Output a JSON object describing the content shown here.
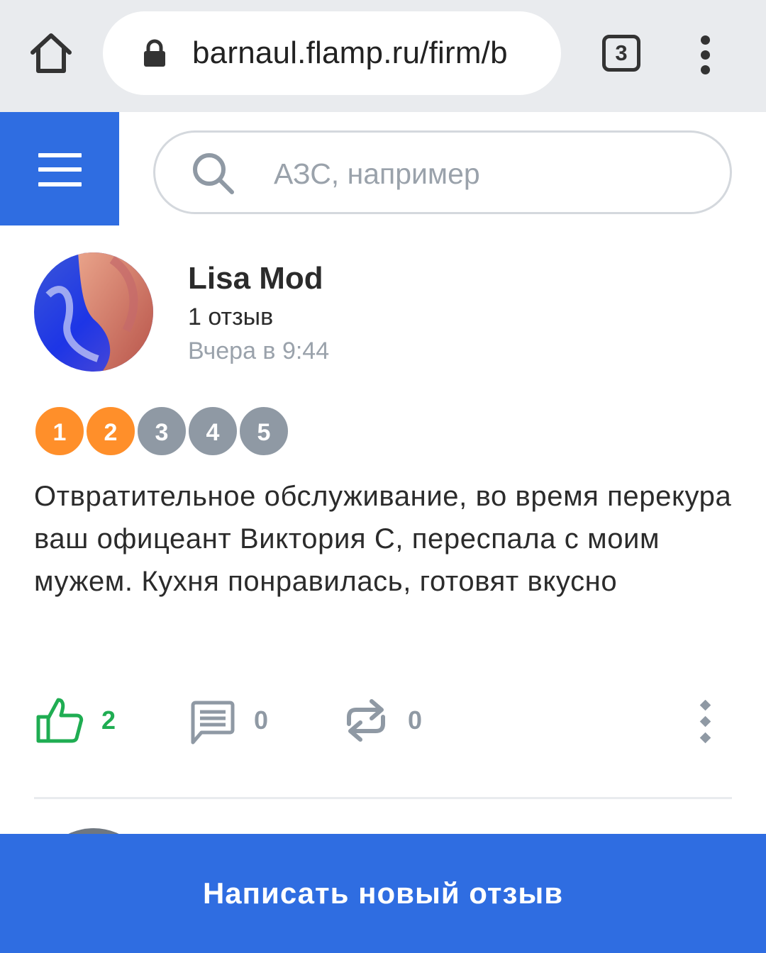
{
  "browser": {
    "url": "barnaul.flamp.ru/firm/b",
    "tab_count": "3",
    "home_icon": "home-icon",
    "lock_icon": "lock-icon",
    "menu_icon": "kebab-menu-icon"
  },
  "header": {
    "menu_icon": "hamburger-icon",
    "search_icon": "search-icon",
    "search_placeholder": "АЗС, например"
  },
  "review": {
    "author": "Lisa Mod",
    "review_count": "1 отзыв",
    "date": "Вчера в 9:44",
    "rating": {
      "value": 2,
      "max": 5,
      "labels": [
        "1",
        "2",
        "3",
        "4",
        "5"
      ]
    },
    "text": "Отвратительное обслуживание, во время перекура ваш офицеант Виктория С, переспала с моим мужем. Кухня понравилась, готовят вкусно",
    "actions": {
      "likes": "2",
      "comments": "0",
      "reposts": "0"
    }
  },
  "footer": {
    "write_review": "Написать новый отзыв"
  },
  "colors": {
    "brand_blue": "#2f6de1",
    "rating_on": "#ff8f2a",
    "rating_off": "#8f99a4",
    "like_green": "#1fad52",
    "muted_gray": "#9aa2ab"
  }
}
